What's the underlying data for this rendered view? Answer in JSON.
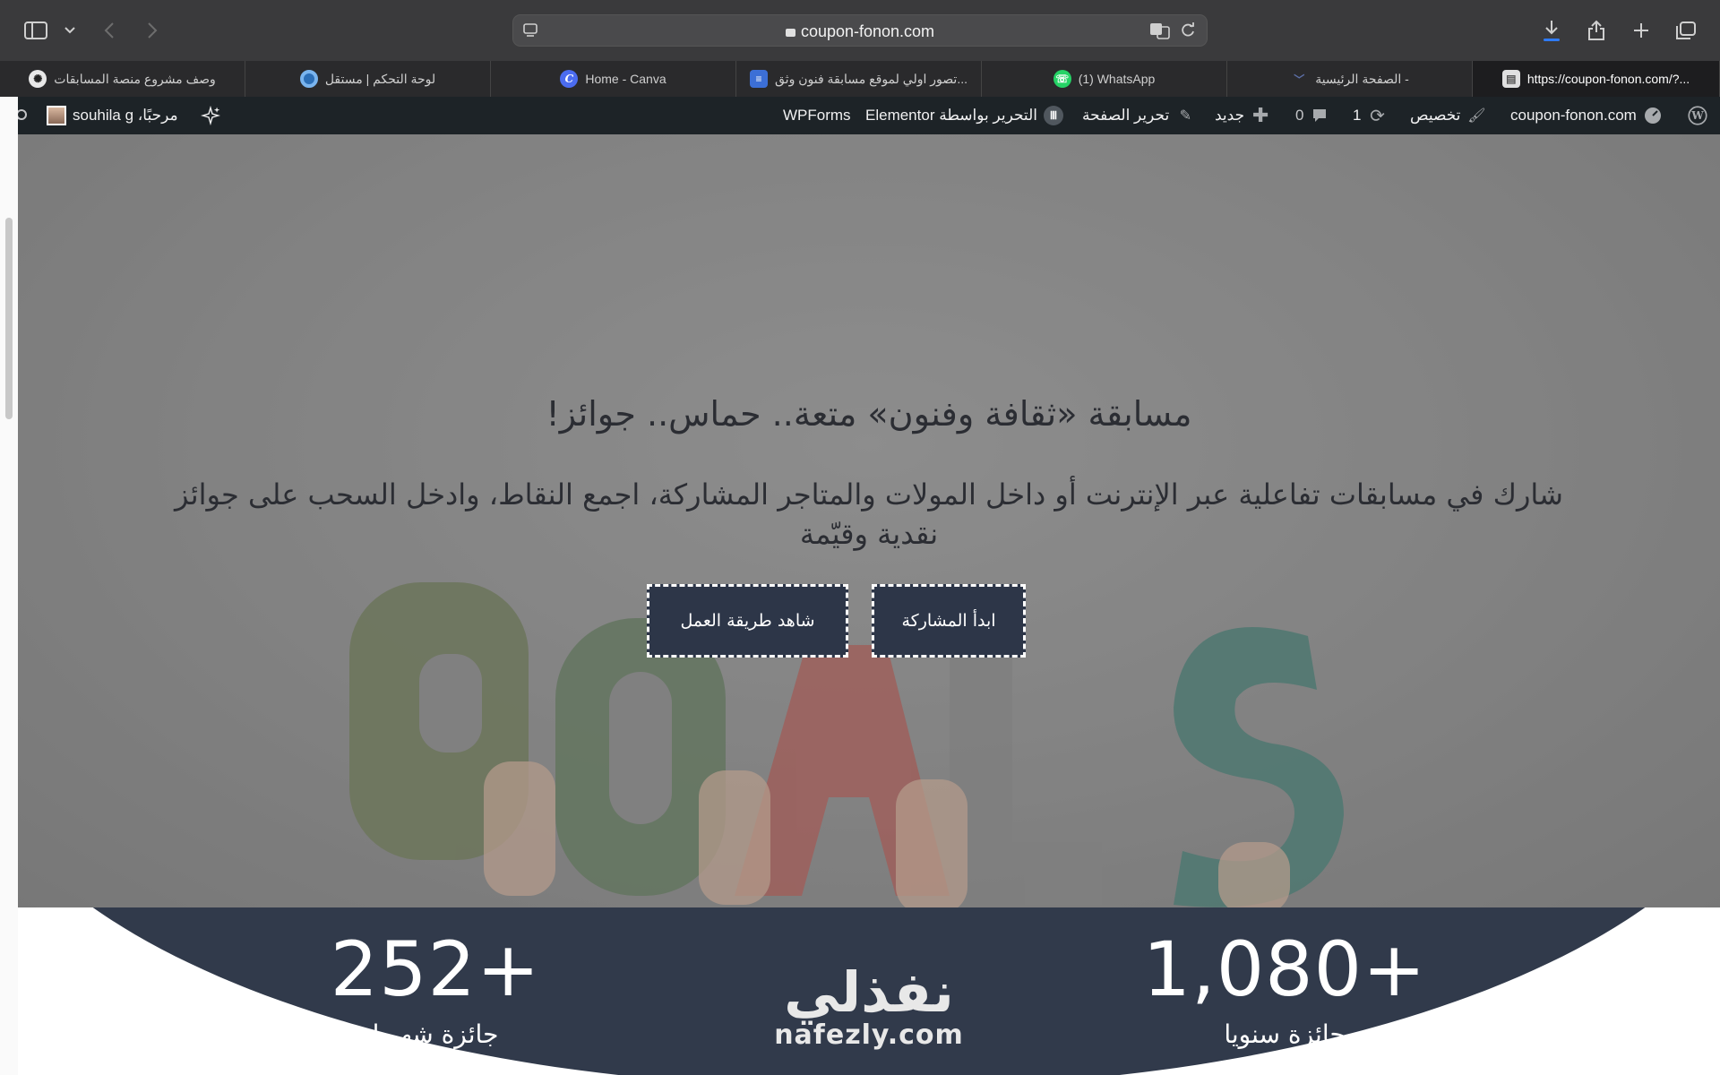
{
  "browser": {
    "url": "coupon-fonon.com",
    "tabs": [
      {
        "label": "وصف مشروع منصة المسابقات",
        "icon": "chatgpt-icon"
      },
      {
        "label": "لوحة التحكم | مستقل",
        "icon": "mostaql-icon"
      },
      {
        "label": "Home - Canva",
        "icon": "canva-icon"
      },
      {
        "label": "تصور اولي لموقع مسابقة فنون وثق...",
        "icon": "doc-icon"
      },
      {
        "label": "(1) WhatsApp",
        "icon": "whatsapp-icon"
      },
      {
        "label": "الصفحة الرئيسية -",
        "icon": "site-icon"
      },
      {
        "label": "https://coupon-fonon.com/?...",
        "icon": "page-icon",
        "active": true
      }
    ]
  },
  "wpbar": {
    "site": "coupon-fonon.com",
    "customize": "تخصيص",
    "updates": "1",
    "comments": "0",
    "new": "جديد",
    "edit_page": "تحرير الصفحة",
    "elementor": "التحرير بواسطة Elementor",
    "wpforms": "WPForms",
    "greeting": "مرحبًا، souhila g"
  },
  "hero": {
    "title": "مسابقة «ثقافة وفنون» متعة.. حماس.. جوائز!",
    "subtitle": "شارك في مسابقات تفاعلية عبر الإنترنت أو داخل المولات والمتاجر المشاركة، اجمع النقاط، وادخل السحب على جوائز نقدية وقيّمة",
    "primary_button": "ابدأ المشاركة",
    "secondary_button": "شاهد طريقة العمل",
    "background_word": "GOALS"
  },
  "stats": {
    "yearly_value": "+1,080",
    "yearly_label": "جائزة سنويا",
    "monthly_value": "+252",
    "monthly_label": "جائزة شهريا",
    "logo_ar": "نفذلي",
    "logo_en": "nafezly.com"
  },
  "colors": {
    "band": "#313a4b",
    "button": "#2d3648",
    "wpbar": "#1d2327",
    "goal_letters": [
      "#5d6b43",
      "#4f6b4a",
      "#a94a44",
      "#7a7a7a",
      "#2f6f64"
    ]
  }
}
